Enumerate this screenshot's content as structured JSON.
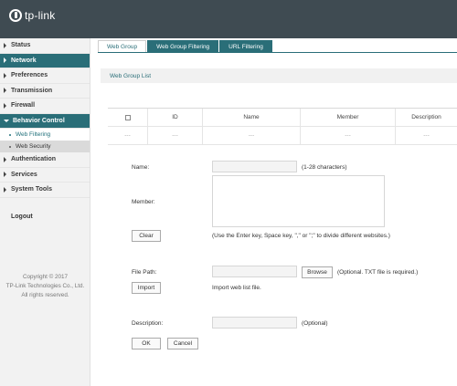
{
  "brand": {
    "name": "tp-link"
  },
  "sidebar": {
    "items": [
      {
        "label": "Status"
      },
      {
        "label": "Network"
      },
      {
        "label": "Preferences"
      },
      {
        "label": "Transmission"
      },
      {
        "label": "Firewall"
      },
      {
        "label": "Behavior Control"
      },
      {
        "label": "Authentication"
      },
      {
        "label": "Services"
      },
      {
        "label": "System Tools"
      }
    ],
    "subitems": [
      {
        "label": "Web Filtering"
      },
      {
        "label": "Web Security"
      }
    ],
    "logout": "Logout",
    "copyright": [
      "Copyright © 2017",
      "TP-Link Technologies Co., Ltd.",
      "All rights reserved."
    ]
  },
  "tabs": [
    {
      "label": "Web Group"
    },
    {
      "label": "Web Group Filtering"
    },
    {
      "label": "URL Filtering"
    }
  ],
  "section": {
    "title": "Web Group List"
  },
  "table": {
    "headers": [
      "",
      "ID",
      "Name",
      "Member",
      "Description"
    ],
    "empty_row": [
      "---",
      "---",
      "---",
      "---",
      "---"
    ]
  },
  "form": {
    "name_label": "Name:",
    "name_hint": "(1-28 characters)",
    "member_label": "Member:",
    "clear_button": "Clear",
    "member_hint": "(Use the Enter key, Space key, \",\" or \";\" to divide different websites.)",
    "file_label": "File Path:",
    "browse_button": "Browse",
    "file_hint": "(Optional. TXT file is required.)",
    "import_button": "Import",
    "import_hint": "Import web list file.",
    "desc_label": "Description:",
    "desc_hint": "(Optional)",
    "ok_button": "OK",
    "cancel_button": "Cancel"
  },
  "colors": {
    "header": "#3f4b52",
    "accent": "#2a6e78",
    "sidebar": "#f2f2f2"
  }
}
